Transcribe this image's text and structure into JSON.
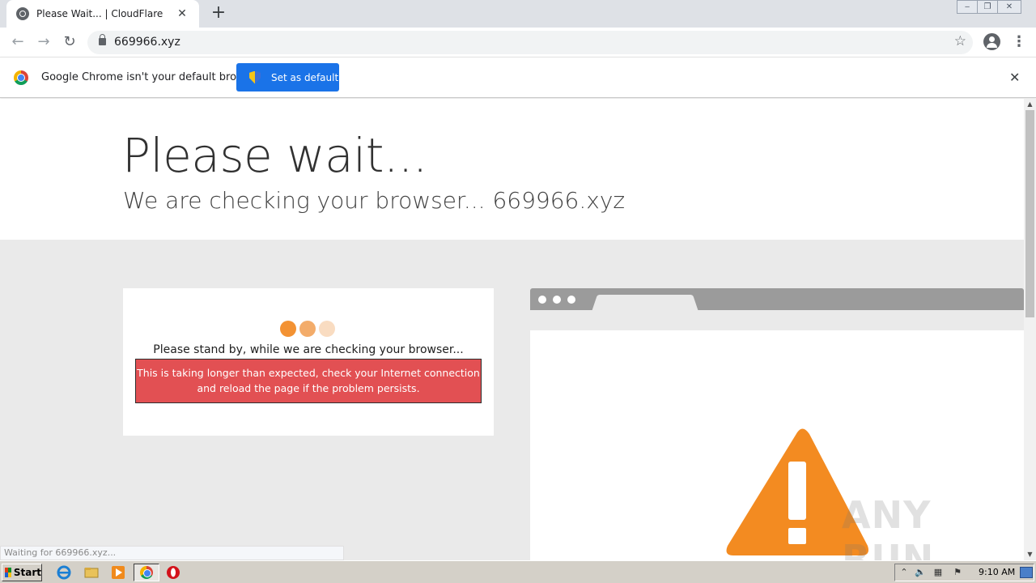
{
  "browser": {
    "tab_title": "Please Wait... | CloudFlare",
    "url": "669966.xyz",
    "infobar": {
      "message": "Google Chrome isn't your default browser",
      "button_label": "Set as default"
    },
    "status_text": "Waiting for 669966.xyz..."
  },
  "page": {
    "heading": "Please wait...",
    "subheading": "We are checking your browser... 669966.xyz",
    "standby_text": "Please stand by, while we are checking your browser...",
    "alert_line1": "This is taking longer than expected, check your Internet connection",
    "alert_line2": "and reload the page if the problem persists.",
    "loading_dot_colors": [
      "#f39233",
      "#f3ac6a",
      "#f9dcc1"
    ],
    "warning_color": "#f38b21"
  },
  "watermark": "ANY RUN",
  "taskbar": {
    "start_label": "Start",
    "clock": "9:10 AM"
  }
}
